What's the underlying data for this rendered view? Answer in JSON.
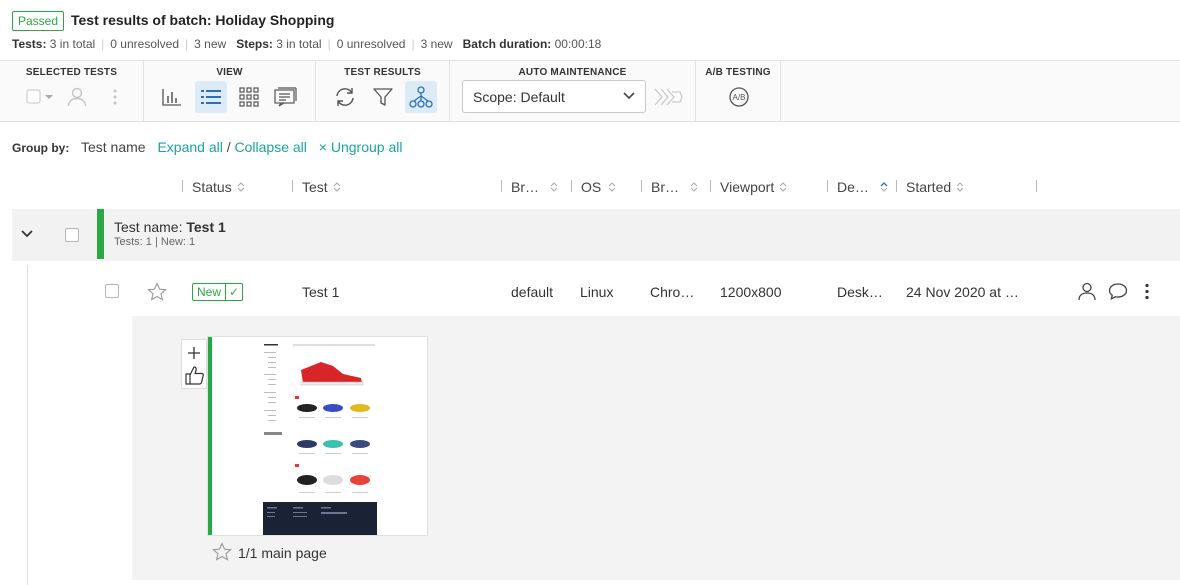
{
  "header": {
    "status_badge": "Passed",
    "title": "Test results of batch: Holiday Shopping",
    "tests_label": "Tests:",
    "tests_total": "3 in total",
    "tests_unresolved": "0 unresolved",
    "tests_new": "3 new",
    "steps_label": "Steps:",
    "steps_total": "3 in total",
    "steps_unresolved": "0 unresolved",
    "steps_new": "3 new",
    "duration_label": "Batch duration:",
    "duration_value": "00:00:18"
  },
  "toolbar": {
    "selected_tests_title": "SELECTED TESTS",
    "view_title": "VIEW",
    "test_results_title": "TEST RESULTS",
    "auto_maintenance_title": "AUTO MAINTENANCE",
    "ab_testing_title": "A/B TESTING",
    "scope_value": "Scope: Default"
  },
  "groupby": {
    "label": "Group by:",
    "value": "Test name",
    "expand_all": "Expand all",
    "slash": "/",
    "collapse_all": "Collapse all",
    "ungroup_icon": "×",
    "ungroup_all": "Ungroup all"
  },
  "columns": {
    "status": "Status",
    "test": "Test",
    "browser": "Br…",
    "os": "OS",
    "browser2": "Br…",
    "viewport": "Viewport",
    "device": "De…",
    "started": "Started"
  },
  "group": {
    "name_label": "Test name:",
    "name_value": "Test 1",
    "tests_count": "Tests: 1",
    "new_count": "New: 1"
  },
  "row": {
    "status": "New",
    "status_check": "✓",
    "test": "Test 1",
    "browser": "default",
    "os": "Linux",
    "browser2": "Chro…",
    "viewport": "1200x800",
    "device": "Desk…",
    "started": "24 Nov 2020 at …"
  },
  "step": {
    "caption": "1/1 main page"
  },
  "colors": {
    "accent": "#1aa59b",
    "passed": "#2aa844",
    "active_icon_bg": "#dcebf7"
  }
}
